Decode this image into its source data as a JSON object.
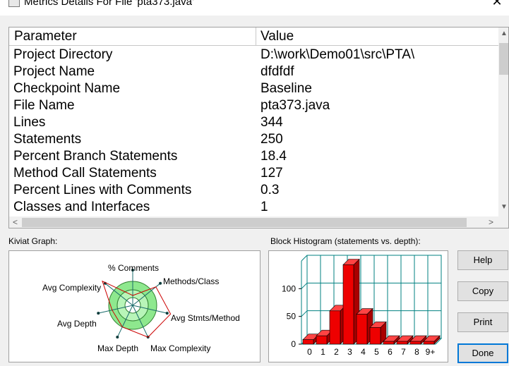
{
  "window": {
    "title": "Metrics Details For File 'pta373.java'",
    "close_glyph": "✕"
  },
  "table": {
    "headers": {
      "parameter": "Parameter",
      "value": "Value"
    },
    "rows": [
      {
        "parameter": "Project Directory",
        "value": "D:\\work\\Demo01\\src\\PTA\\"
      },
      {
        "parameter": "Project Name",
        "value": "dfdfdf"
      },
      {
        "parameter": "Checkpoint Name",
        "value": "Baseline"
      },
      {
        "parameter": "File Name",
        "value": "pta373.java"
      },
      {
        "parameter": "Lines",
        "value": "344"
      },
      {
        "parameter": "Statements",
        "value": "250"
      },
      {
        "parameter": "Percent Branch Statements",
        "value": "18.4"
      },
      {
        "parameter": "Method Call Statements",
        "value": "127"
      },
      {
        "parameter": "Percent Lines with Comments",
        "value": "0.3"
      },
      {
        "parameter": "Classes and Interfaces",
        "value": "1"
      }
    ]
  },
  "kiviat": {
    "label": "Kiviat Graph:",
    "axes": [
      {
        "name": "% Comments"
      },
      {
        "name": "Methods/Class"
      },
      {
        "name": "Avg Stmts/Method"
      },
      {
        "name": "Max Complexity"
      },
      {
        "name": "Max Depth"
      },
      {
        "name": "Avg Depth"
      },
      {
        "name": "Avg Complexity"
      }
    ],
    "colors": {
      "band": "#8ee88e",
      "polygon": "#cc0000",
      "axis": "#1a6b6b"
    }
  },
  "histogram": {
    "label": "Block Histogram (statements vs. depth):",
    "colors": {
      "bar": "#ee0000",
      "grid": "#008080"
    },
    "chart_data": {
      "type": "bar",
      "categories": [
        "0",
        "1",
        "2",
        "3",
        "4",
        "5",
        "6",
        "7",
        "8",
        "9+"
      ],
      "values": [
        8,
        15,
        60,
        143,
        54,
        30,
        5,
        5,
        5,
        5
      ],
      "ytick_labels": [
        "0",
        "50",
        "100"
      ],
      "ylim": [
        0,
        150
      ],
      "grid": true
    }
  },
  "buttons": {
    "help": "Help",
    "copy": "Copy",
    "print": "Print",
    "done": "Done"
  }
}
